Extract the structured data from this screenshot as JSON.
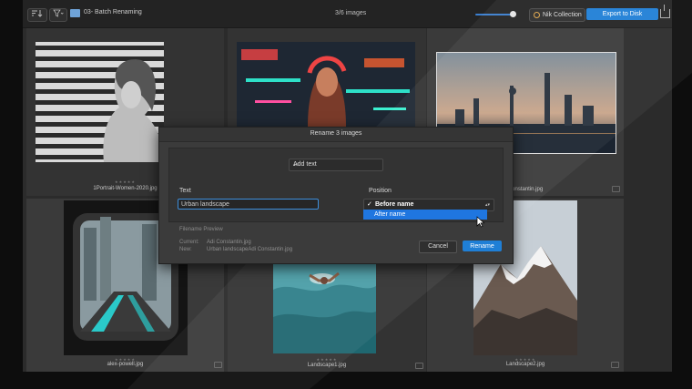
{
  "topbar": {
    "folder_name": "03- Batch Renaming",
    "image_count": "3/6 images",
    "nik_label": "Nik Collection",
    "export_label": "Export to Disk"
  },
  "grid": {
    "captions": [
      "1Portrait-Women-2020.jpg",
      "",
      "Constantin.jpg",
      "alex-powell.jpg",
      "Landscape1.jpg",
      "Landscape2.jpg"
    ],
    "stars": "★★★★★"
  },
  "dialog": {
    "title": "Rename 3 images",
    "add_select": "Add text",
    "text_label": "Text",
    "text_value": "Urban landscape",
    "position_label": "Position",
    "position_selected": "Before name",
    "position_option2": "After name",
    "preview_header": "Filename Preview",
    "current_label": "Current:",
    "current_value": "Adi Constantin.jpg",
    "new_label": "New:",
    "new_value": "Urban landscapeAdi Constantin.jpg",
    "cancel_label": "Cancel",
    "rename_label": "Rename"
  },
  "colors": {
    "accent": "#1f7fd6",
    "highlight": "#1f76e0"
  }
}
